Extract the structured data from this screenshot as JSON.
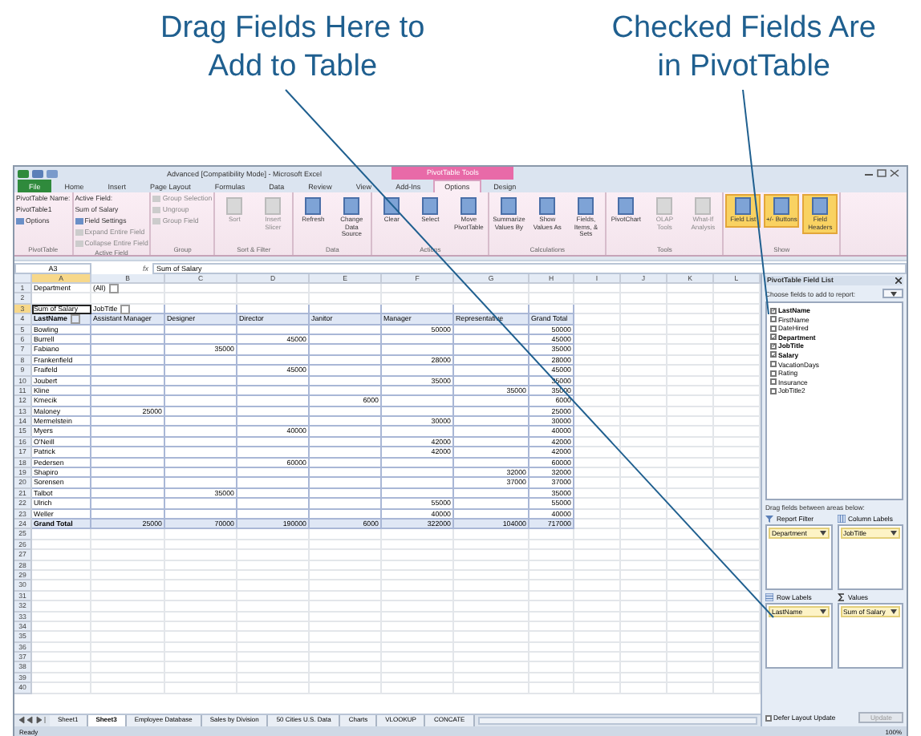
{
  "callouts": [
    {
      "lines": [
        "Drag Fields Here to",
        "Add to Table"
      ]
    },
    {
      "lines": [
        "Checked Fields Are",
        "in PivotTable"
      ]
    }
  ],
  "window": {
    "title": "Advanced [Compatibility Mode] - Microsoft Excel",
    "contextual_tab": "PivotTable Tools"
  },
  "ribbon_tabs": [
    {
      "label": "File",
      "selected": false,
      "kind": "file"
    },
    {
      "label": "Home",
      "selected": false,
      "kind": "tab"
    },
    {
      "label": "Insert",
      "selected": false,
      "kind": "tab"
    },
    {
      "label": "Page Layout",
      "selected": false,
      "kind": "tab"
    },
    {
      "label": "Formulas",
      "selected": false,
      "kind": "tab"
    },
    {
      "label": "Data",
      "selected": false,
      "kind": "tab"
    },
    {
      "label": "Review",
      "selected": false,
      "kind": "tab"
    },
    {
      "label": "View",
      "selected": false,
      "kind": "tab"
    },
    {
      "label": "Add-Ins",
      "selected": false,
      "kind": "tab"
    },
    {
      "label": "Options",
      "selected": true,
      "kind": "tab"
    },
    {
      "label": "Design",
      "selected": false,
      "kind": "tab"
    }
  ],
  "ribbon_groups": [
    {
      "label": "PivotTable",
      "items": [
        {
          "label": "PivotTable Name:",
          "kind": "text",
          "disabled": false
        },
        {
          "label": "PivotTable1",
          "kind": "text",
          "disabled": false
        },
        {
          "label": "Options",
          "kind": "small",
          "disabled": false
        }
      ]
    },
    {
      "label": "Active Field",
      "items": [
        {
          "label": "Active Field:",
          "kind": "text",
          "disabled": false
        },
        {
          "label": "Sum of Salary",
          "kind": "text",
          "disabled": false
        },
        {
          "label": "Field Settings",
          "kind": "small",
          "disabled": false
        },
        {
          "label": "Expand Entire Field",
          "kind": "small",
          "disabled": true
        },
        {
          "label": "Collapse Entire Field",
          "kind": "small",
          "disabled": true
        }
      ]
    },
    {
      "label": "Group",
      "items": [
        {
          "label": "Group Selection",
          "kind": "small",
          "disabled": true
        },
        {
          "label": "Ungroup",
          "kind": "small",
          "disabled": true
        },
        {
          "label": "Group Field",
          "kind": "small",
          "disabled": true
        }
      ]
    },
    {
      "label": "Sort & Filter",
      "items": [
        {
          "label": "Sort",
          "kind": "large",
          "disabled": true
        },
        {
          "label": "Insert Slicer",
          "kind": "large",
          "disabled": true
        }
      ]
    },
    {
      "label": "Data",
      "items": [
        {
          "label": "Refresh",
          "kind": "large",
          "disabled": false
        },
        {
          "label": "Change Data Source",
          "kind": "large",
          "disabled": false
        }
      ]
    },
    {
      "label": "Actions",
      "items": [
        {
          "label": "Clear",
          "kind": "large",
          "disabled": false
        },
        {
          "label": "Select",
          "kind": "large",
          "disabled": false
        },
        {
          "label": "Move PivotTable",
          "kind": "large",
          "disabled": false
        }
      ]
    },
    {
      "label": "Calculations",
      "items": [
        {
          "label": "Summarize Values By",
          "kind": "large",
          "disabled": false
        },
        {
          "label": "Show Values As",
          "kind": "large",
          "disabled": false
        },
        {
          "label": "Fields, Items, & Sets",
          "kind": "large",
          "disabled": false
        }
      ]
    },
    {
      "label": "Tools",
      "items": [
        {
          "label": "PivotChart",
          "kind": "large",
          "disabled": false
        },
        {
          "label": "OLAP Tools",
          "kind": "large",
          "disabled": true
        },
        {
          "label": "What-If Analysis",
          "kind": "large",
          "disabled": true
        }
      ]
    },
    {
      "label": "Show",
      "items": [
        {
          "label": "Field List",
          "kind": "large",
          "disabled": false,
          "on": true
        },
        {
          "label": "+/- Buttons",
          "kind": "large",
          "disabled": false,
          "on": true
        },
        {
          "label": "Field Headers",
          "kind": "large",
          "disabled": false,
          "on": true
        }
      ]
    }
  ],
  "formula_bar": {
    "name_box": "A3",
    "fx": "fx",
    "value": "Sum of Salary"
  },
  "columns": [
    {
      "label": "A",
      "selected": true
    },
    {
      "label": "B",
      "selected": false
    },
    {
      "label": "C",
      "selected": false
    },
    {
      "label": "D",
      "selected": false
    },
    {
      "label": "E",
      "selected": false
    },
    {
      "label": "F",
      "selected": false
    },
    {
      "label": "G",
      "selected": false
    },
    {
      "label": "H",
      "selected": false
    },
    {
      "label": "I",
      "selected": false
    },
    {
      "label": "J",
      "selected": false
    },
    {
      "label": "K",
      "selected": false
    },
    {
      "label": "L",
      "selected": false
    }
  ],
  "rows": [
    {
      "number": "1",
      "kind": "filter",
      "selected": false,
      "cells": {
        "A": "Department",
        "B": "(All)"
      }
    },
    {
      "number": "2",
      "kind": "empty",
      "selected": false
    },
    {
      "number": "3",
      "kind": "pivot-top",
      "selected": true,
      "cells": {
        "A": "Sum of Salary",
        "B": "JobTitle"
      }
    },
    {
      "number": "4",
      "kind": "pivot-header",
      "selected": false,
      "cells": {
        "A": "LastName",
        "B": "Assistant Manager",
        "C": "Designer",
        "D": "Director",
        "E": "Janitor",
        "F": "Manager",
        "G": "Representative",
        "H": "Grand Total"
      }
    },
    {
      "number": "5",
      "kind": "pivot-row",
      "selected": false,
      "cells": {
        "A": "Bowling",
        "F": "50000",
        "H": "50000"
      }
    },
    {
      "number": "6",
      "kind": "pivot-row",
      "selected": false,
      "cells": {
        "A": "Burrell",
        "D": "45000",
        "H": "45000"
      }
    },
    {
      "number": "7",
      "kind": "pivot-row",
      "selected": false,
      "cells": {
        "A": "Fabiano",
        "C": "35000",
        "H": "35000"
      }
    },
    {
      "number": "8",
      "kind": "pivot-row",
      "selected": false,
      "cells": {
        "A": "Frankenfield",
        "F": "28000",
        "H": "28000"
      }
    },
    {
      "number": "9",
      "kind": "pivot-row",
      "selected": false,
      "cells": {
        "A": "Fraifeld",
        "D": "45000",
        "H": "45000"
      }
    },
    {
      "number": "10",
      "kind": "pivot-row",
      "selected": false,
      "cells": {
        "A": "Joubert",
        "F": "35000",
        "H": "35000"
      }
    },
    {
      "number": "11",
      "kind": "pivot-row",
      "selected": false,
      "cells": {
        "A": "Kline",
        "G": "35000",
        "H": "35000"
      }
    },
    {
      "number": "12",
      "kind": "pivot-row",
      "selected": false,
      "cells": {
        "A": "Kmecik",
        "E": "6000",
        "H": "6000"
      }
    },
    {
      "number": "13",
      "kind": "pivot-row",
      "selected": false,
      "cells": {
        "A": "Maloney",
        "B": "25000",
        "H": "25000"
      }
    },
    {
      "number": "14",
      "kind": "pivot-row",
      "selected": false,
      "cells": {
        "A": "Mermelstein",
        "F": "30000",
        "H": "30000"
      }
    },
    {
      "number": "15",
      "kind": "pivot-row",
      "selected": false,
      "cells": {
        "A": "Myers",
        "D": "40000",
        "H": "40000"
      }
    },
    {
      "number": "16",
      "kind": "pivot-row",
      "selected": false,
      "cells": {
        "A": "O'Neill",
        "F": "42000",
        "H": "42000"
      }
    },
    {
      "number": "17",
      "kind": "pivot-row",
      "selected": false,
      "cells": {
        "A": "Patrick",
        "F": "42000",
        "H": "42000"
      }
    },
    {
      "number": "18",
      "kind": "pivot-row",
      "selected": false,
      "cells": {
        "A": "Pedersen",
        "D": "60000",
        "H": "60000"
      }
    },
    {
      "number": "19",
      "kind": "pivot-row",
      "selected": false,
      "cells": {
        "A": "Shapiro",
        "G": "32000",
        "H": "32000"
      }
    },
    {
      "number": "20",
      "kind": "pivot-row",
      "selected": false,
      "cells": {
        "A": "Sorensen",
        "G": "37000",
        "H": "37000"
      }
    },
    {
      "number": "21",
      "kind": "pivot-row",
      "selected": false,
      "cells": {
        "A": "Talbot",
        "C": "35000",
        "H": "35000"
      }
    },
    {
      "number": "22",
      "kind": "pivot-row",
      "selected": false,
      "cells": {
        "A": "Ulrich",
        "F": "55000",
        "H": "55000"
      }
    },
    {
      "number": "23",
      "kind": "pivot-row",
      "selected": false,
      "cells": {
        "A": "Weller",
        "F": "40000",
        "H": "40000"
      }
    },
    {
      "number": "24",
      "kind": "pivot-total",
      "selected": false,
      "cells": {
        "A": "Grand Total",
        "B": "25000",
        "C": "70000",
        "D": "190000",
        "E": "6000",
        "F": "322000",
        "G": "104000",
        "H": "717000"
      }
    },
    {
      "number": "25",
      "kind": "empty",
      "selected": false
    },
    {
      "number": "26",
      "kind": "empty",
      "selected": false
    },
    {
      "number": "27",
      "kind": "empty",
      "selected": false
    },
    {
      "number": "28",
      "kind": "empty",
      "selected": false
    },
    {
      "number": "29",
      "kind": "empty",
      "selected": false
    },
    {
      "number": "30",
      "kind": "empty",
      "selected": false
    },
    {
      "number": "31",
      "kind": "empty",
      "selected": false
    },
    {
      "number": "32",
      "kind": "empty",
      "selected": false
    },
    {
      "number": "33",
      "kind": "empty",
      "selected": false
    },
    {
      "number": "34",
      "kind": "empty",
      "selected": false
    },
    {
      "number": "35",
      "kind": "empty",
      "selected": false
    },
    {
      "number": "36",
      "kind": "empty",
      "selected": false
    },
    {
      "number": "37",
      "kind": "empty",
      "selected": false
    },
    {
      "number": "38",
      "kind": "empty",
      "selected": false
    },
    {
      "number": "39",
      "kind": "empty",
      "selected": false
    },
    {
      "number": "40",
      "kind": "empty",
      "selected": false
    }
  ],
  "sheet_tabs": [
    {
      "label": "Sheet1",
      "selected": false
    },
    {
      "label": "Sheet3",
      "selected": true
    },
    {
      "label": "Employee Database",
      "selected": false
    },
    {
      "label": "Sales by Division",
      "selected": false
    },
    {
      "label": "50 Cities U.S. Data",
      "selected": false
    },
    {
      "label": "Charts",
      "selected": false
    },
    {
      "label": "VLOOKUP",
      "selected": false
    },
    {
      "label": "CONCATE",
      "selected": false
    }
  ],
  "status_bar": {
    "text": "Ready",
    "zoom": "100%"
  },
  "field_list": {
    "title": "PivotTable Field List",
    "choose_label": "Choose fields to add to report:",
    "fields": [
      {
        "label": "LastName",
        "checked": true
      },
      {
        "label": "FirstName",
        "checked": false
      },
      {
        "label": "DateHired",
        "checked": false
      },
      {
        "label": "Department",
        "checked": true
      },
      {
        "label": "JobTitle",
        "checked": true
      },
      {
        "label": "Salary",
        "checked": true
      },
      {
        "label": "VacationDays",
        "checked": false
      },
      {
        "label": "Rating",
        "checked": false
      },
      {
        "label": "Insurance",
        "checked": false
      },
      {
        "label": "JobTitle2",
        "checked": false
      }
    ],
    "areas_label": "Drag fields between areas below:",
    "areas": [
      {
        "label": "Report Filter",
        "kind": "filter",
        "items": [
          "Department"
        ]
      },
      {
        "label": "Column Labels",
        "kind": "columns",
        "items": [
          "JobTitle"
        ]
      },
      {
        "label": "Row Labels",
        "kind": "rows",
        "items": [
          "LastName"
        ]
      },
      {
        "label": "Values",
        "kind": "values",
        "items": [
          "Sum of Salary"
        ]
      }
    ],
    "defer": {
      "label": "Defer Layout Update",
      "checked": false
    },
    "update_button": {
      "label": "Update",
      "disabled": true
    }
  }
}
